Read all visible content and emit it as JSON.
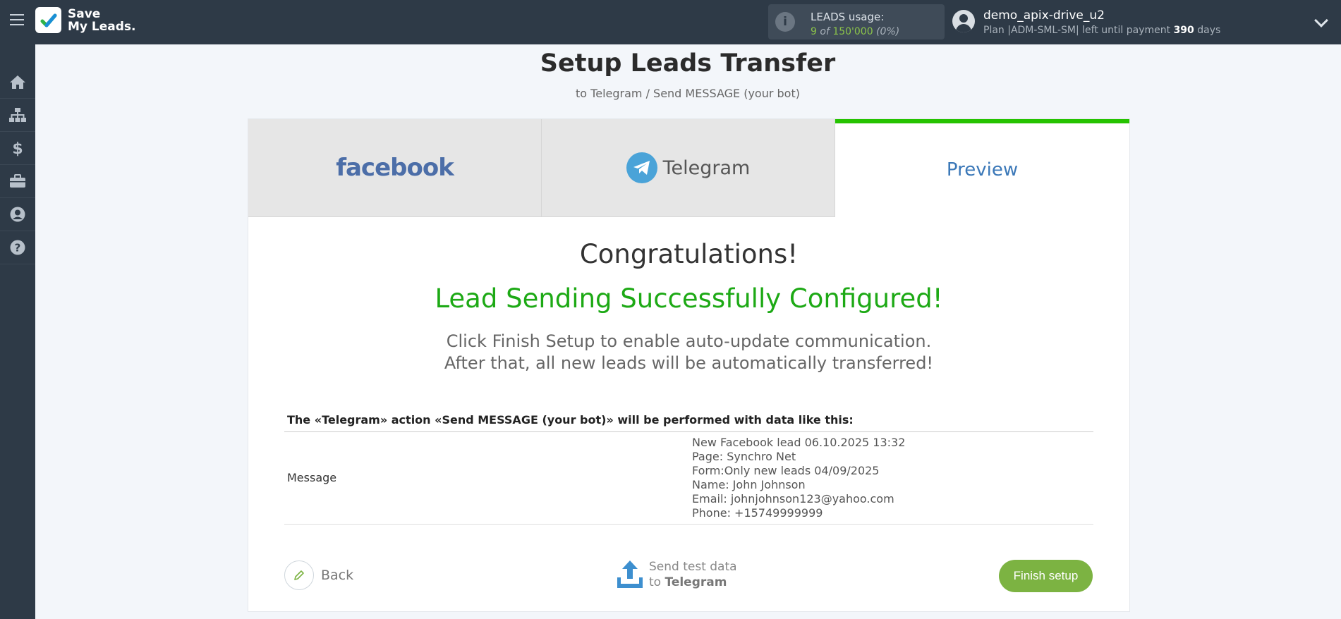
{
  "topbar": {
    "logo_line1": "Save",
    "logo_line2": "My Leads.",
    "usage_label": "LEADS usage:",
    "usage_used": "9",
    "usage_of": "of",
    "usage_total": "150'000",
    "usage_pct": "(0%)",
    "user_name": "demo_apix-drive_u2",
    "plan_prefix": "Plan |ADM-SML-SM| left until payment",
    "plan_days": "390",
    "plan_suffix": "days"
  },
  "sidebar": {
    "items": [
      "home-icon",
      "sitemap-icon",
      "dollar-icon",
      "briefcase-icon",
      "user-icon",
      "help-icon"
    ]
  },
  "page": {
    "title": "Setup Leads Transfer",
    "subtitle": "to Telegram / Send MESSAGE (your bot)"
  },
  "tabs": {
    "source": "facebook",
    "destination": "Telegram",
    "preview": "Preview"
  },
  "result": {
    "congrats": "Congratulations!",
    "success": "Lead Sending Successfully Configured!",
    "hint_line1": "Click Finish Setup to enable auto-update communication.",
    "hint_line2": "After that, all new leads will be automatically transferred!"
  },
  "table": {
    "description": "The «Telegram» action «Send MESSAGE (your bot)» will be performed with data like this:",
    "field_name": "Message",
    "value_lines": [
      "New Facebook lead 06.10.2025 13:32",
      "Page: Synchro Net",
      "Form:Only new leads 04/09/2025",
      "Name: John Johnson",
      "Email: johnjohnson123@yahoo.com",
      "Phone: +15749999999"
    ]
  },
  "footer": {
    "back": "Back",
    "send_line1": "Send test data",
    "send_to": "to",
    "send_target": "Telegram",
    "finish": "Finish setup"
  },
  "colors": {
    "topbar": "#2e3a47",
    "accent_green": "#1da915",
    "finish_button": "#7cb342",
    "preview_tab_bar": "#26c300",
    "preview_text": "#3b78b8"
  }
}
